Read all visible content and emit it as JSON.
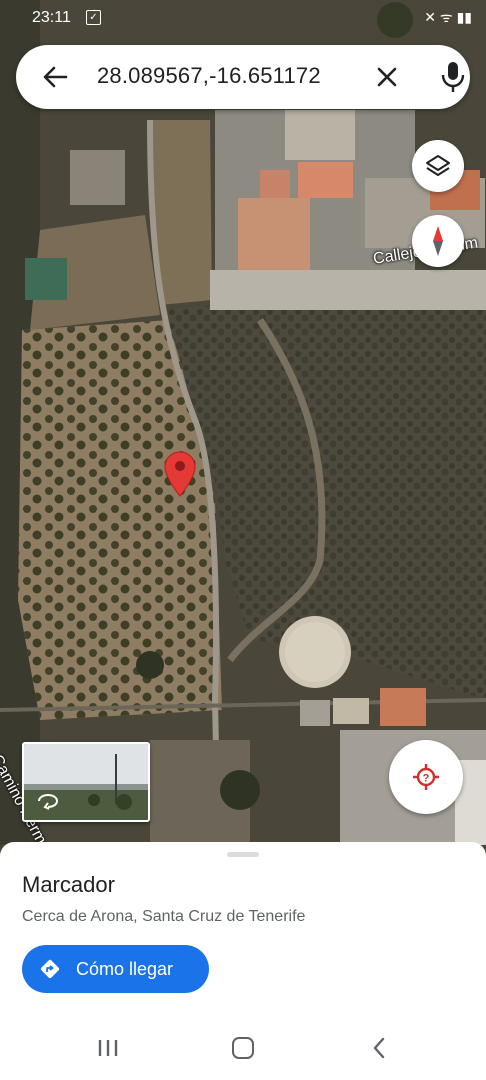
{
  "status_bar": {
    "time": "23:11",
    "check_glyph": "✓",
    "signal_glyph": "✕ ᯤ ▮▮"
  },
  "search": {
    "value": "28.089567,-16.651172"
  },
  "map": {
    "street_labels": [
      "Callejón el Alm",
      "Camino Herm"
    ]
  },
  "place": {
    "name": "Marcador",
    "address": "Cerca de Arona, Santa Cruz de Tenerife"
  },
  "actions": {
    "directions_label": "Cómo llegar"
  },
  "icons": {
    "back": "back-arrow-icon",
    "clear": "close-icon",
    "mic": "microphone-icon",
    "layers": "layers-icon",
    "compass": "compass-icon",
    "location": "my-location-icon",
    "pin": "map-pin-icon",
    "directions": "directions-icon",
    "street_view": "street-view-icon"
  },
  "colors": {
    "accent": "#1a73e8",
    "pin": "#e53935",
    "location": "#d32f2f"
  }
}
